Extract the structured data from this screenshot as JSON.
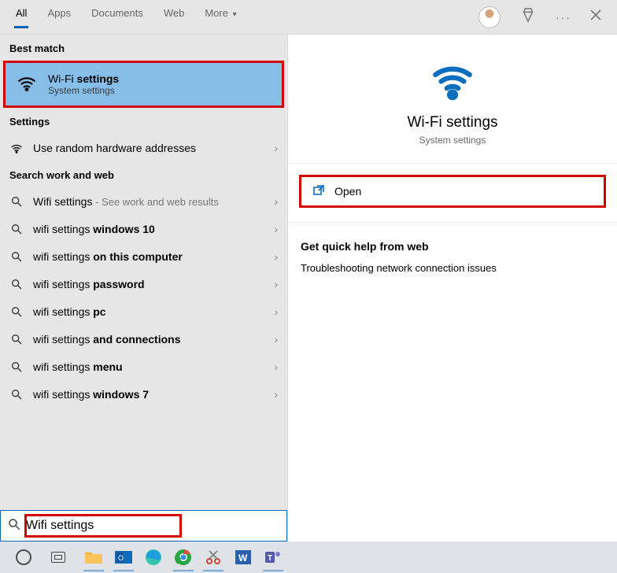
{
  "tabs": {
    "all": "All",
    "apps": "Apps",
    "documents": "Documents",
    "web": "Web",
    "more": "More"
  },
  "left": {
    "best_match_header": "Best match",
    "best_match": {
      "title_pre": "Wi-Fi ",
      "title_bold": "settings",
      "subtitle": "System settings"
    },
    "settings_header": "Settings",
    "settings_item": "Use random hardware addresses",
    "search_header": "Search work and web",
    "suggestions": [
      {
        "pre": "Wifi settings",
        "bold": "",
        "hint": " - See work and web results"
      },
      {
        "pre": "wifi settings ",
        "bold": "windows 10",
        "hint": ""
      },
      {
        "pre": "wifi settings ",
        "bold": "on this computer",
        "hint": ""
      },
      {
        "pre": "wifi settings ",
        "bold": "password",
        "hint": ""
      },
      {
        "pre": "wifi settings ",
        "bold": "pc",
        "hint": ""
      },
      {
        "pre": "wifi settings ",
        "bold": "and connections",
        "hint": ""
      },
      {
        "pre": "wifi settings ",
        "bold": "menu",
        "hint": ""
      },
      {
        "pre": "wifi settings ",
        "bold": "windows 7",
        "hint": ""
      }
    ]
  },
  "right": {
    "title": "Wi-Fi settings",
    "subtitle": "System settings",
    "open": "Open",
    "help_header": "Get quick help from web",
    "help_link": "Troubleshooting network connection issues"
  },
  "search": {
    "value": "Wifi settings"
  },
  "colors": {
    "accent": "#0160ba",
    "highlight": "#d30000"
  }
}
